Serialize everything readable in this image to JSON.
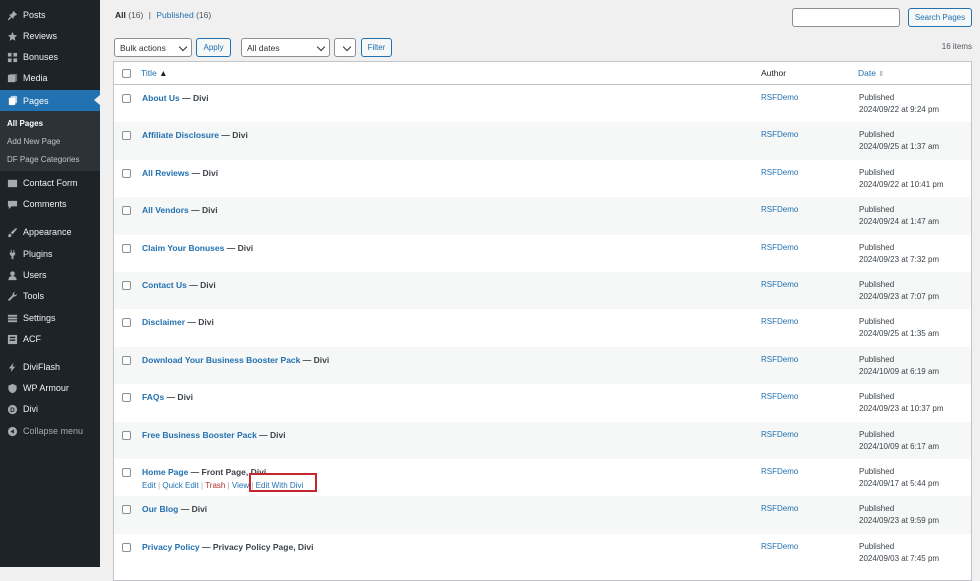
{
  "sidebar": {
    "items": [
      {
        "label": "Posts",
        "icon": "pin-icon"
      },
      {
        "label": "Reviews",
        "icon": "star-icon"
      },
      {
        "label": "Bonuses",
        "icon": "grid-icon"
      },
      {
        "label": "Media",
        "icon": "media-icon"
      },
      {
        "label": "Pages",
        "icon": "pages-icon",
        "active": true
      },
      {
        "label": "Contact Form",
        "icon": "mail-icon"
      },
      {
        "label": "Comments",
        "icon": "comment-icon"
      },
      {
        "label": "Appearance",
        "icon": "brush-icon"
      },
      {
        "label": "Plugins",
        "icon": "plug-icon"
      },
      {
        "label": "Users",
        "icon": "user-icon"
      },
      {
        "label": "Tools",
        "icon": "wrench-icon"
      },
      {
        "label": "Settings",
        "icon": "settings-icon"
      },
      {
        "label": "ACF",
        "icon": "acf-icon"
      },
      {
        "label": "DiviFlash",
        "icon": "bolt-icon"
      },
      {
        "label": "WP Armour",
        "icon": "shield-icon"
      },
      {
        "label": "Divi",
        "icon": "divi-icon"
      },
      {
        "label": "Collapse menu",
        "icon": "collapse-icon"
      }
    ],
    "submenu": [
      "All Pages",
      "Add New Page",
      "DF Page Categories"
    ]
  },
  "filters": {
    "all_label": "All",
    "all_count": "(16)",
    "separator": "|",
    "published_label": "Published",
    "published_count": "(16)"
  },
  "search": {
    "button": "Search Pages",
    "value": ""
  },
  "bulk": {
    "select": "Bulk actions",
    "apply": "Apply",
    "dates": "All dates",
    "filter": "Filter"
  },
  "items_count": "16 items",
  "columns": {
    "title": "Title",
    "author": "Author",
    "date": "Date"
  },
  "rows": [
    {
      "title": "About Us",
      "state": " — Divi",
      "author": "RSFDemo",
      "status": "Published",
      "date": "2024/09/22 at 9:24 pm"
    },
    {
      "title": "Affiliate Disclosure",
      "state": " — Divi",
      "author": "RSFDemo",
      "status": "Published",
      "date": "2024/09/25 at 1:37 am"
    },
    {
      "title": "All Reviews",
      "state": " — Divi",
      "author": "RSFDemo",
      "status": "Published",
      "date": "2024/09/22 at 10:41 pm"
    },
    {
      "title": "All Vendors",
      "state": " — Divi",
      "author": "RSFDemo",
      "status": "Published",
      "date": "2024/09/24 at 1:47 am"
    },
    {
      "title": "Claim Your Bonuses",
      "state": " — Divi",
      "author": "RSFDemo",
      "status": "Published",
      "date": "2024/09/23 at 7:32 pm"
    },
    {
      "title": "Contact Us",
      "state": " — Divi",
      "author": "RSFDemo",
      "status": "Published",
      "date": "2024/09/23 at 7:07 pm"
    },
    {
      "title": "Disclaimer",
      "state": " — Divi",
      "author": "RSFDemo",
      "status": "Published",
      "date": "2024/09/25 at 1:35 am"
    },
    {
      "title": "Download Your Business Booster Pack",
      "state": " — Divi",
      "author": "RSFDemo",
      "status": "Published",
      "date": "2024/10/09 at 6:19 am"
    },
    {
      "title": "FAQs",
      "state": " — Divi",
      "author": "RSFDemo",
      "status": "Published",
      "date": "2024/09/23 at 10:37 pm"
    },
    {
      "title": "Free Business Booster Pack",
      "state": " — Divi",
      "author": "RSFDemo",
      "status": "Published",
      "date": "2024/10/09 at 6:17 am"
    },
    {
      "title": "Home Page",
      "state": " — Front Page, Divi",
      "author": "RSFDemo",
      "status": "Published",
      "date": "2024/09/17 at 5:44 pm"
    },
    {
      "title": "Our Blog",
      "state": " — Divi",
      "author": "RSFDemo",
      "status": "Published",
      "date": "2024/09/23 at 9:59 pm"
    },
    {
      "title": "Privacy Policy",
      "state": " — Privacy Policy Page, Divi",
      "author": "RSFDemo",
      "status": "Published",
      "date": "2024/09/03 at 7:45 pm"
    }
  ],
  "row_actions": {
    "edit": "Edit",
    "quick_edit": "Quick Edit",
    "trash": "Trash",
    "view": "View",
    "edit_divi": "Edit With Divi",
    "sep": "|"
  },
  "colors": {
    "accent": "#2271b1",
    "sidebar": "#1d2327",
    "highlight": "#c4282d",
    "trash": "#b32d2e"
  }
}
